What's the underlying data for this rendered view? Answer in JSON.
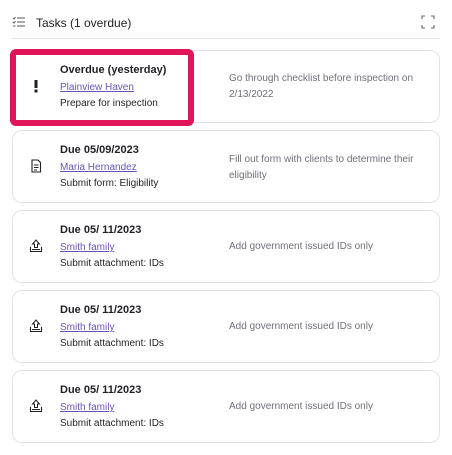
{
  "header": {
    "icon": "checklist-icon",
    "title": "Tasks (1 overdue)",
    "expand_icon": "expand-icon"
  },
  "colors": {
    "link": "#6b54b8",
    "highlight": "#e01458",
    "border": "#e1e2e6"
  },
  "tasks": [
    {
      "icon": "exclamation-icon",
      "title": "Overdue (yesterday)",
      "link": "Plainview Haven",
      "subtitle": "Prepare for inspection",
      "description": "Go through checklist before inspection on 2/13/2022",
      "highlighted": true
    },
    {
      "icon": "form-icon",
      "title": "Due 05/09/2023",
      "link": "Maria Hernandez",
      "subtitle": "Submit form: Eligibility",
      "description": "Fill out form with clients to determine their eligibility"
    },
    {
      "icon": "upload-icon",
      "title": "Due 05/ 11/2023",
      "link": "Smith family",
      "subtitle": "Submit attachment: IDs",
      "description": "Add government issued IDs only"
    },
    {
      "icon": "upload-icon",
      "title": "Due 05/ 11/2023",
      "link": "Smith family",
      "subtitle": "Submit attachment: IDs",
      "description": "Add government issued IDs only"
    },
    {
      "icon": "upload-icon",
      "title": "Due 05/ 11/2023",
      "link": "Smith family",
      "subtitle": "Submit attachment: IDs",
      "description": "Add government issued IDs only"
    }
  ]
}
